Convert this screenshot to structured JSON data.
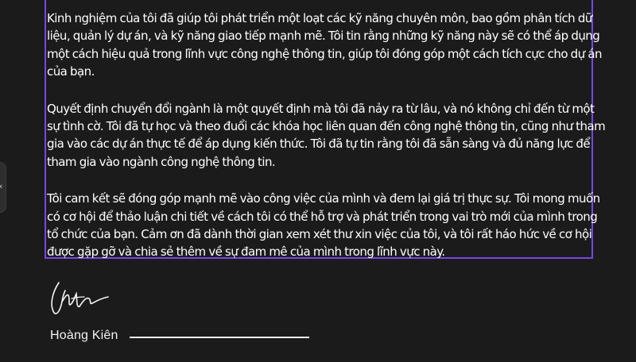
{
  "letter": {
    "paragraphs": [
      {
        "lines": [
          "Kinh nghiệm của tôi đã giúp tôi phát triển một loạt các kỹ năng chuyên môn, bao gồm phân tích dữ",
          "liệu, quản lý dự án, và kỹ năng giao tiếp mạnh mẽ. Tôi tin rằng những kỹ năng này sẽ có thể áp dụng",
          "một cách hiệu quả trong lĩnh vực công nghệ thông tin, giúp tôi đóng góp một cách tích cực cho dự án",
          "của bạn."
        ]
      },
      {
        "lines": [
          "Quyết định chuyển đổi ngành là một quyết định mà tôi đã nảy ra từ lâu, và nó không chỉ đến từ một",
          "sự tình cờ. Tôi đã tự học và theo đuổi các khóa học liên quan đến công nghệ thông tin, cũng như tham",
          "gia vào các dự án thực tế để áp dụng kiến thức. Tôi đã tự tin rằng tôi đã sẵn sàng và đủ năng lực để",
          "tham gia vào ngành công nghệ thông tin."
        ]
      },
      {
        "lines": [
          "Tôi cam kết sẽ đóng góp mạnh mẽ vào công việc của mình và đem lại giá trị thực sự. Tôi mong muốn",
          "có cơ hội để thảo luận chi tiết về cách tôi có thể hỗ trợ và phát triển trong vai trò mới của mình trong",
          "tổ chức của bạn. Cảm ơn đã dành thời gian xem xét thư xin việc của tôi, và tôi rất háo hức về cơ hội",
          "được gặp gỡ và chia sẻ thêm về sự đam mê của mình trong lĩnh vực này."
        ]
      }
    ]
  },
  "signoff": {
    "name": "Hoàng Kiên"
  },
  "ui": {
    "handle_icon": "chevron-left-icon",
    "handle_glyph": "‹",
    "selection_color": "#7a45e8",
    "background_color": "#1b1b1b"
  }
}
